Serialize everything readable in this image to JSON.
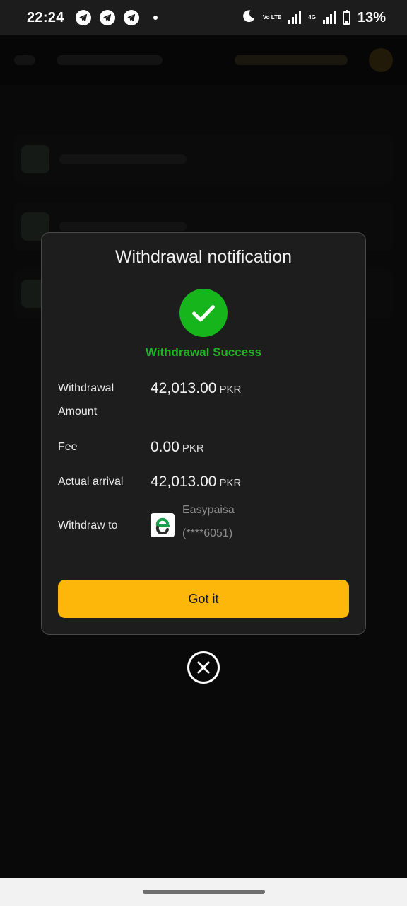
{
  "status_bar": {
    "time": "22:24",
    "icons": [
      "telegram-icon",
      "telegram-icon",
      "telegram-icon",
      "notification-dot",
      "dnd-moon-icon",
      "volte-icon",
      "signal-icon",
      "4g-signal-icon",
      "battery-icon"
    ],
    "volte_label": "Vo LTE",
    "network_label": "4G",
    "battery_level": 0.13,
    "battery_text": "13%"
  },
  "modal": {
    "title": "Withdrawal notification",
    "status_icon": "check-icon",
    "status_text": "Withdrawal Success",
    "rows": {
      "amount": {
        "label": "Withdrawal Amount",
        "value": "42,013.00",
        "currency": "PKR"
      },
      "fee": {
        "label": "Fee",
        "value": "0.00",
        "currency": "PKR"
      },
      "actual": {
        "label": "Actual arrival",
        "value": "42,013.00",
        "currency": "PKR"
      },
      "withdraw_to": {
        "label": "Withdraw to",
        "method_icon": "easypaisa-logo",
        "method_name": "Easypaisa",
        "account": "(****6051)"
      }
    },
    "confirm_label": "Got it"
  },
  "close_icon": "close-circle-icon",
  "colors": {
    "accent": "#fdb60a",
    "success": "#16b51c",
    "modal_bg": "#1d1d1d",
    "background": "#1c1c1c"
  }
}
